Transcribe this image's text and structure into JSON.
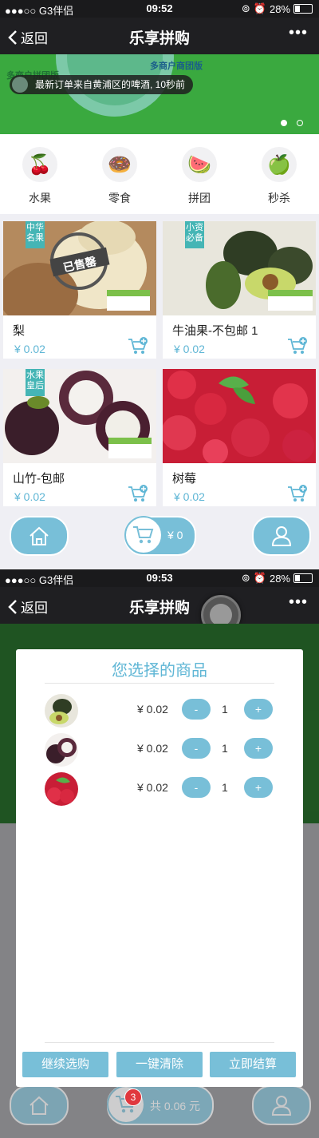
{
  "status_bar_1": {
    "carrier": "●●●○○ G3伴侣",
    "time": "09:52",
    "battery": "28%"
  },
  "status_bar_2": {
    "carrier": "●●●○○ G3伴侣",
    "time": "09:53",
    "battery": "28%"
  },
  "nav": {
    "back_label": "返回",
    "title": "乐享拼购",
    "more": "•••"
  },
  "banner": {
    "brand_text": "多商户商团版",
    "brand_left": "多商户拼团版",
    "order_toast": "最新订单来自黄浦区的啤酒, 10秒前",
    "slides": 2,
    "active_slide": 1
  },
  "categories": [
    {
      "label": "水果",
      "icon": "cherry-icon",
      "glyph": "🍒"
    },
    {
      "label": "零食",
      "icon": "donut-icon",
      "glyph": "🍩"
    },
    {
      "label": "拼团",
      "icon": "watermelon-icon",
      "glyph": "🍉"
    },
    {
      "label": "秒杀",
      "icon": "apple-icon",
      "glyph": "🍏"
    }
  ],
  "products": [
    {
      "name": "梨",
      "price": "¥ 0.02",
      "tag": "中华名果",
      "stamp": "已售罄",
      "color": "#c9a27a"
    },
    {
      "name": "牛油果-不包邮 1",
      "price": "¥ 0.02",
      "tag": "小资必备",
      "color": "#4d6b3a"
    },
    {
      "name": "山竹-包邮",
      "price": "¥ 0.02",
      "tag": "水果皇后",
      "color": "#5a2a3a"
    },
    {
      "name": "树莓",
      "price": "¥ 0.02",
      "tag": "",
      "color": "#d8283e"
    }
  ],
  "dock_1": {
    "cart_amount": "¥ 0"
  },
  "modal": {
    "title": "您选择的商品",
    "items": [
      {
        "product": "牛油果-不包邮 1",
        "price": "¥ 0.02",
        "minus": "-",
        "qty": "1",
        "plus": "+"
      },
      {
        "product": "山竹-包邮",
        "price": "¥ 0.02",
        "minus": "-",
        "qty": "1",
        "plus": "+"
      },
      {
        "product": "树莓",
        "price": "¥ 0.02",
        "minus": "-",
        "qty": "1",
        "plus": "+"
      }
    ],
    "continue_label": "继续选购",
    "clear_label": "一键清除",
    "checkout_label": "立即结算"
  },
  "dock_2": {
    "cart_total": "共 0.06 元",
    "badge_count": "3"
  },
  "colors": {
    "accent": "#78bfd8",
    "price": "#5fb6d5",
    "tag": "#45b5b5",
    "banner": "#3aa93f"
  }
}
